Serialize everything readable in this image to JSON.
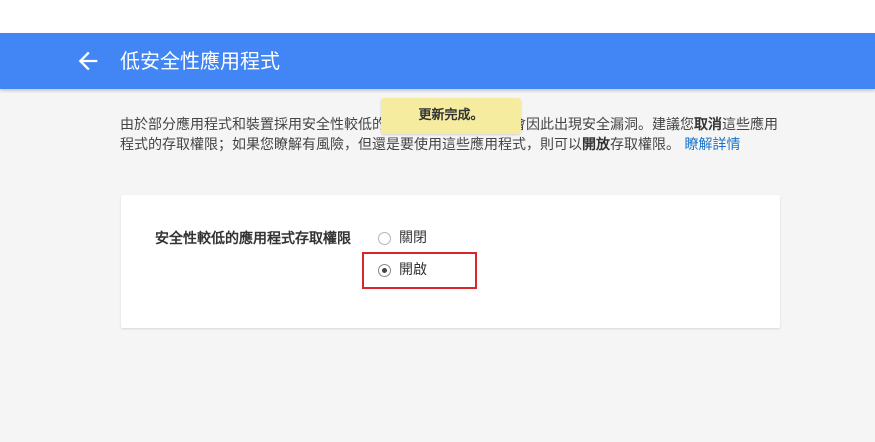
{
  "header": {
    "title": "低安全性應用程式",
    "back_icon": "arrow-back-icon",
    "color": "#4285f4"
  },
  "toast": {
    "text": "更新完成。",
    "color": "#f6ec9f"
  },
  "description": {
    "part1": "由於部分應用程式和裝置採用安全性較低的登入技術，導致帳戶會因此出現安全漏洞。建議您",
    "bold1": "取消",
    "part2": "這些應用程式的存取權限；如果您瞭解有風險，但還是要使用這些應用程式，則可以",
    "bold2": "開放",
    "part3": "存取權限。",
    "link": "瞭解詳情",
    "link_color": "#1a73c8"
  },
  "setting": {
    "label": "安全性較低的應用程式存取權限",
    "options": [
      {
        "label": "關閉",
        "checked": false
      },
      {
        "label": "開啟",
        "checked": true
      }
    ]
  },
  "annotation": {
    "highlight_color": "#d9262c"
  }
}
